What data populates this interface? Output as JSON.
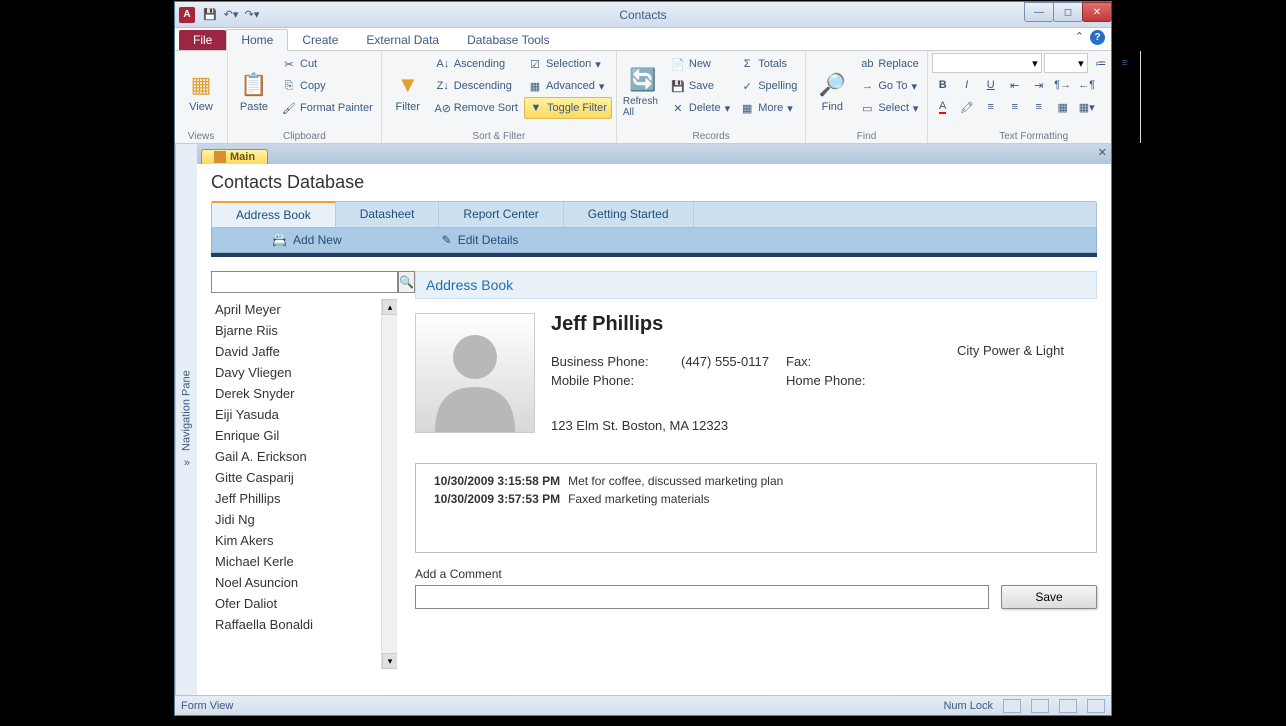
{
  "title": "Contacts",
  "ribbon": {
    "tabs": [
      "File",
      "Home",
      "Create",
      "External Data",
      "Database Tools"
    ],
    "active": "Home",
    "views": {
      "view": "View",
      "group": "Views"
    },
    "clipboard": {
      "paste": "Paste",
      "cut": "Cut",
      "copy": "Copy",
      "fp": "Format Painter",
      "group": "Clipboard"
    },
    "sortfilter": {
      "filter": "Filter",
      "asc": "Ascending",
      "desc": "Descending",
      "remove": "Remove Sort",
      "selection": "Selection",
      "advanced": "Advanced",
      "toggle": "Toggle Filter",
      "group": "Sort & Filter"
    },
    "records": {
      "refresh": "Refresh All",
      "new": "New",
      "save": "Save",
      "delete": "Delete",
      "totals": "Totals",
      "spelling": "Spelling",
      "more": "More",
      "group": "Records"
    },
    "find": {
      "find": "Find",
      "replace": "Replace",
      "goto": "Go To",
      "select": "Select",
      "group": "Find"
    },
    "format": {
      "group": "Text Formatting"
    }
  },
  "doctab": "Main",
  "nav_label": "Navigation Pane",
  "form": {
    "title": "Contacts Database",
    "tabs": [
      "Address Book",
      "Datasheet",
      "Report Center",
      "Getting Started"
    ],
    "active": "Address Book",
    "addnew": "Add New",
    "edit": "Edit Details",
    "section": "Address Book",
    "contacts": [
      "April Meyer",
      "Bjarne Riis",
      "David Jaffe",
      "Davy Vliegen",
      "Derek Snyder",
      "Eiji Yasuda",
      "Enrique Gil",
      "Gail A. Erickson",
      "Gitte Casparij",
      "Jeff Phillips",
      "Jidi Ng",
      "Kim Akers",
      "Michael Kerle",
      "Noel Asuncion",
      "Ofer Daliot",
      "Raffaella Bonaldi"
    ],
    "detail": {
      "name": "Jeff Phillips",
      "company": "City Power & Light",
      "bphone_lbl": "Business Phone:",
      "bphone": "(447) 555-0117",
      "mphone_lbl": "Mobile Phone:",
      "fax_lbl": "Fax:",
      "hphone_lbl": "Home Phone:",
      "address": "123 Elm St. Boston, MA 12323"
    },
    "notes": [
      {
        "ts": "10/30/2009 3:15:58 PM",
        "txt": "Met for coffee, discussed marketing plan"
      },
      {
        "ts": "10/30/2009 3:57:53 PM",
        "txt": "Faxed marketing materials"
      }
    ],
    "comment_lbl": "Add a Comment",
    "save": "Save"
  },
  "status": {
    "left": "Form View",
    "numlock": "Num Lock"
  }
}
